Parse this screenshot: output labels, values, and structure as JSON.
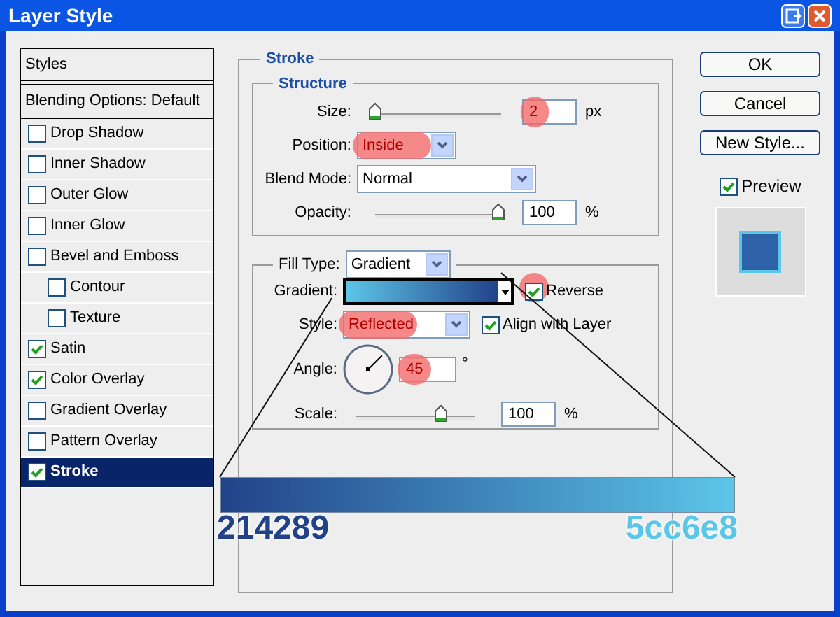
{
  "window": {
    "title": "Layer Style"
  },
  "sidebar": {
    "items": [
      {
        "kind": "header",
        "label": "Styles",
        "selected": false
      },
      {
        "kind": "header",
        "label": "Blending Options: Default",
        "selected": false
      },
      {
        "kind": "check",
        "label": "Drop Shadow",
        "checked": false,
        "selected": false
      },
      {
        "kind": "check",
        "label": "Inner Shadow",
        "checked": false,
        "selected": false
      },
      {
        "kind": "check",
        "label": "Outer Glow",
        "checked": false,
        "selected": false
      },
      {
        "kind": "check",
        "label": "Inner Glow",
        "checked": false,
        "selected": false
      },
      {
        "kind": "check",
        "label": "Bevel and Emboss",
        "checked": false,
        "selected": false,
        "children": [
          {
            "kind": "check",
            "label": "Contour",
            "checked": false,
            "selected": false
          },
          {
            "kind": "check",
            "label": "Texture",
            "checked": false,
            "selected": false
          }
        ]
      },
      {
        "kind": "check",
        "label": "Satin",
        "checked": true,
        "selected": false
      },
      {
        "kind": "check",
        "label": "Color Overlay",
        "checked": true,
        "selected": false
      },
      {
        "kind": "check",
        "label": "Gradient Overlay",
        "checked": false,
        "selected": false
      },
      {
        "kind": "check",
        "label": "Pattern Overlay",
        "checked": false,
        "selected": false
      },
      {
        "kind": "check",
        "label": "Stroke",
        "checked": true,
        "selected": true
      }
    ]
  },
  "stroke": {
    "title": "Stroke",
    "structure": {
      "title": "Structure",
      "size": {
        "label": "Size:",
        "level": 0,
        "value": "2",
        "unit": "px",
        "highlighted": true
      },
      "position": {
        "label": "Position:",
        "value": "Inside",
        "highlighted": true
      },
      "blend_mode": {
        "label": "Blend Mode:",
        "value": "Normal"
      },
      "opacity": {
        "label": "Opacity:",
        "level": 1,
        "value": "100",
        "unit": "%"
      }
    },
    "fill": {
      "label": "Fill Type:",
      "value": "Gradient",
      "gradient": {
        "label": "Gradient:"
      },
      "reverse": {
        "label": "Reverse",
        "checked": true,
        "highlighted": true
      },
      "style": {
        "label": "Style:",
        "value": "Reflected",
        "highlighted": true
      },
      "align": {
        "label": "Align with Layer",
        "checked": true
      },
      "angle": {
        "label": "Angle:",
        "value": "45",
        "unit": "°",
        "highlighted": true
      },
      "scale": {
        "label": "Scale:",
        "level": 0.72,
        "value": "100",
        "unit": "%"
      }
    }
  },
  "buttons": [
    "OK",
    "Cancel",
    "New Style..."
  ],
  "preview": {
    "label": "Preview",
    "checked": true
  },
  "gradient_bar": {
    "stops": [
      {
        "label": "214289",
        "color": "#214289"
      },
      {
        "label": "5cc6e8",
        "color": "#5cc6e8"
      }
    ]
  }
}
